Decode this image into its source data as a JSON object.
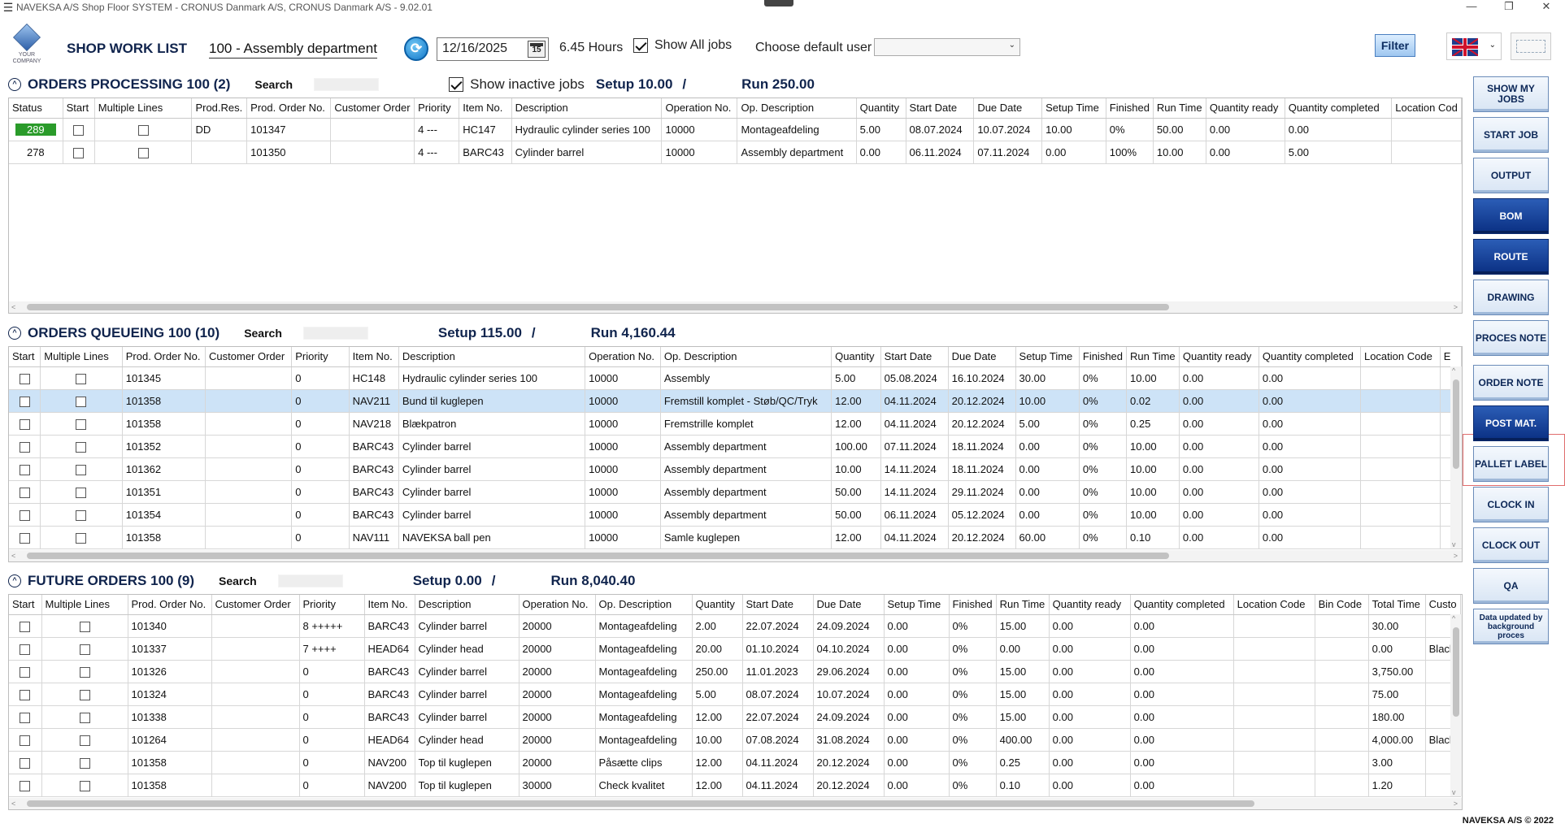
{
  "window": {
    "title": "NAVEKSA A/S Shop Floor SYSTEM - CRONUS Danmark A/S, CRONUS Danmark A/S - 9.02.01",
    "controls": [
      "—",
      "❐",
      "✕"
    ]
  },
  "header": {
    "logo_caption": "YOUR COMPANY",
    "app_title": "SHOP WORK LIST",
    "department": "100 - Assembly department",
    "date": "12/16/2025",
    "calendar_day": "15",
    "hours": "6.45 Hours",
    "show_all_jobs_label": "Show All jobs",
    "show_all_jobs_checked": true,
    "default_user_label": "Choose default user",
    "default_user_value": "",
    "filter_label": "Filter",
    "language": "en-GB"
  },
  "processing": {
    "title": "ORDERS PROCESSING 100 (2)",
    "search_label": "Search",
    "show_inactive_label": "Show inactive jobs",
    "setup": "Setup 10.00",
    "slash": "/",
    "run": "Run 250.00",
    "columns": [
      "Status",
      "Start",
      "Multiple Lines",
      "Prod.Res.",
      "Prod. Order No.",
      "Customer Order",
      "Priority",
      "Item No.",
      "Description",
      "Operation No.",
      "Op. Description",
      "Quantity",
      "Start Date",
      "Due Date",
      "Setup Time",
      "Finished",
      "Run Time",
      "Quantity ready",
      "Quantity completed",
      "Location Cod"
    ],
    "rows": [
      [
        "289",
        "",
        "",
        "DD",
        "101347",
        "",
        "4 ---",
        "HC147",
        "Hydraulic cylinder series 100",
        "10000",
        "Montageafdeling",
        "5.00",
        "08.07.2024",
        "10.07.2024",
        "10.00",
        "0%",
        "50.00",
        "0.00",
        "0.00",
        ""
      ],
      [
        "278",
        "",
        "",
        "",
        "101350",
        "",
        "4 ---",
        "BARC43",
        "Cylinder barrel",
        "10000",
        "Assembly department",
        "0.00",
        "06.11.2024",
        "07.11.2024",
        "0.00",
        "100%",
        "10.00",
        "0.00",
        "5.00",
        ""
      ]
    ]
  },
  "queueing": {
    "title": "ORDERS QUEUEING 100 (10)",
    "search_label": "Search",
    "setup": "Setup 115.00",
    "slash": "/",
    "run": "Run 4,160.44",
    "columns": [
      "Start",
      "Multiple Lines",
      "Prod. Order No.",
      "Customer Order",
      "Priority",
      "Item No.",
      "Description",
      "Operation No.",
      "Op. Description",
      "Quantity",
      "Start Date",
      "Due Date",
      "Setup Time",
      "Finished",
      "Run Time",
      "Quantity ready",
      "Quantity completed",
      "Location Code",
      "E"
    ],
    "rows": [
      [
        "101345",
        "",
        "0",
        "HC148",
        "Hydraulic cylinder series 100",
        "10000",
        "Assembly",
        "5.00",
        "05.08.2024",
        "16.10.2024",
        "30.00",
        "0%",
        "10.00",
        "0.00",
        "0.00",
        "",
        ""
      ],
      [
        "101358",
        "",
        "0",
        "NAV211",
        "Bund til kuglepen",
        "10000",
        "Fremstill komplet - Støb/QC/Tryk",
        "12.00",
        "04.11.2024",
        "20.12.2024",
        "10.00",
        "0%",
        "0.02",
        "0.00",
        "0.00",
        "",
        ""
      ],
      [
        "101358",
        "",
        "0",
        "NAV218",
        "Blækpatron",
        "10000",
        "Fremstrille komplet",
        "12.00",
        "04.11.2024",
        "20.12.2024",
        "5.00",
        "0%",
        "0.25",
        "0.00",
        "0.00",
        "",
        ""
      ],
      [
        "101352",
        "",
        "0",
        "BARC43",
        "Cylinder barrel",
        "10000",
        "Assembly department",
        "100.00",
        "07.11.2024",
        "18.11.2024",
        "0.00",
        "0%",
        "10.00",
        "0.00",
        "0.00",
        "",
        ""
      ],
      [
        "101362",
        "",
        "0",
        "BARC43",
        "Cylinder barrel",
        "10000",
        "Assembly department",
        "10.00",
        "14.11.2024",
        "18.11.2024",
        "0.00",
        "0%",
        "10.00",
        "0.00",
        "0.00",
        "",
        ""
      ],
      [
        "101351",
        "",
        "0",
        "BARC43",
        "Cylinder barrel",
        "10000",
        "Assembly department",
        "50.00",
        "14.11.2024",
        "29.11.2024",
        "0.00",
        "0%",
        "10.00",
        "0.00",
        "0.00",
        "",
        ""
      ],
      [
        "101354",
        "",
        "0",
        "BARC43",
        "Cylinder barrel",
        "10000",
        "Assembly department",
        "50.00",
        "06.11.2024",
        "05.12.2024",
        "0.00",
        "0%",
        "10.00",
        "0.00",
        "0.00",
        "",
        ""
      ],
      [
        "101358",
        "",
        "0",
        "NAV111",
        "NAVEKSA ball pen",
        "10000",
        "Samle kuglepen",
        "12.00",
        "04.11.2024",
        "20.12.2024",
        "60.00",
        "0%",
        "0.10",
        "0.00",
        "0.00",
        "",
        ""
      ]
    ],
    "selected_row": 1
  },
  "future": {
    "title": "FUTURE ORDERS 100 (9)",
    "search_label": "Search",
    "setup": "Setup 0.00",
    "slash": "/",
    "run": "Run 8,040.40",
    "columns": [
      "Start",
      "Multiple Lines",
      "Prod. Order No.",
      "Customer Order",
      "Priority",
      "Item No.",
      "Description",
      "Operation No.",
      "Op. Description",
      "Quantity",
      "Start Date",
      "Due Date",
      "Setup Time",
      "Finished",
      "Run Time",
      "Quantity ready",
      "Quantity completed",
      "Location Code",
      "Bin Code",
      "Total Time",
      "Custo"
    ],
    "rows": [
      [
        "101340",
        "",
        "8 +++++",
        "BARC43",
        "Cylinder barrel",
        "20000",
        "Montageafdeling",
        "2.00",
        "22.07.2024",
        "24.09.2024",
        "0.00",
        "0%",
        "15.00",
        "0.00",
        "0.00",
        "",
        "",
        "30.00",
        ""
      ],
      [
        "101337",
        "",
        "7 ++++",
        "HEAD64",
        "Cylinder head",
        "20000",
        "Montageafdeling",
        "20.00",
        "01.10.2024",
        "04.10.2024",
        "0.00",
        "0%",
        "0.00",
        "0.00",
        "0.00",
        "",
        "",
        "0.00",
        "Black"
      ],
      [
        "101326",
        "",
        "0",
        "BARC43",
        "Cylinder barrel",
        "20000",
        "Montageafdeling",
        "250.00",
        "11.01.2023",
        "29.06.2024",
        "0.00",
        "0%",
        "15.00",
        "0.00",
        "0.00",
        "",
        "",
        "3,750.00",
        ""
      ],
      [
        "101324",
        "",
        "0",
        "BARC43",
        "Cylinder barrel",
        "20000",
        "Montageafdeling",
        "5.00",
        "08.07.2024",
        "10.07.2024",
        "0.00",
        "0%",
        "15.00",
        "0.00",
        "0.00",
        "",
        "",
        "75.00",
        ""
      ],
      [
        "101338",
        "",
        "0",
        "BARC43",
        "Cylinder barrel",
        "20000",
        "Montageafdeling",
        "12.00",
        "22.07.2024",
        "24.09.2024",
        "0.00",
        "0%",
        "15.00",
        "0.00",
        "0.00",
        "",
        "",
        "180.00",
        ""
      ],
      [
        "101264",
        "",
        "0",
        "HEAD64",
        "Cylinder head",
        "20000",
        "Montageafdeling",
        "10.00",
        "07.08.2024",
        "31.08.2024",
        "0.00",
        "0%",
        "400.00",
        "0.00",
        "0.00",
        "",
        "",
        "4,000.00",
        "Black"
      ],
      [
        "101358",
        "",
        "0",
        "NAV200",
        "Top til kuglepen",
        "20000",
        "Påsætte clips",
        "12.00",
        "04.11.2024",
        "20.12.2024",
        "0.00",
        "0%",
        "0.25",
        "0.00",
        "0.00",
        "",
        "",
        "3.00",
        ""
      ],
      [
        "101358",
        "",
        "0",
        "NAV200",
        "Top til kuglepen",
        "30000",
        "Check kvalitet",
        "12.00",
        "04.11.2024",
        "20.12.2024",
        "0.00",
        "0%",
        "0.10",
        "0.00",
        "0.00",
        "",
        "",
        "1.20",
        ""
      ]
    ]
  },
  "sidebar": {
    "buttons": [
      {
        "label": "SHOW MY JOBS",
        "style": "light"
      },
      {
        "label": "START JOB",
        "style": "light"
      },
      {
        "label": "OUTPUT",
        "style": "light"
      },
      {
        "label": "BOM",
        "style": "dark"
      },
      {
        "label": "ROUTE",
        "style": "dark"
      },
      {
        "label": "DRAWING",
        "style": "light"
      },
      {
        "label": "PROCES NOTE",
        "style": "light"
      },
      {
        "label": "ORDER NOTE",
        "style": "light"
      },
      {
        "label": "POST MAT.",
        "style": "dark"
      },
      {
        "label": "PALLET LABEL",
        "style": "light"
      },
      {
        "label": "CLOCK IN",
        "style": "light"
      },
      {
        "label": "CLOCK OUT",
        "style": "light"
      },
      {
        "label": "QA",
        "style": "light"
      },
      {
        "label": "Data updated by background proces",
        "style": "light"
      }
    ]
  },
  "footer": {
    "copyright": "NAVEKSA A/S © 2022"
  },
  "colors": {
    "accent": "#10244d",
    "selected_row": "#cde3f7",
    "status_green": "#2a9b2a",
    "dark_button": "#0a2f82"
  }
}
